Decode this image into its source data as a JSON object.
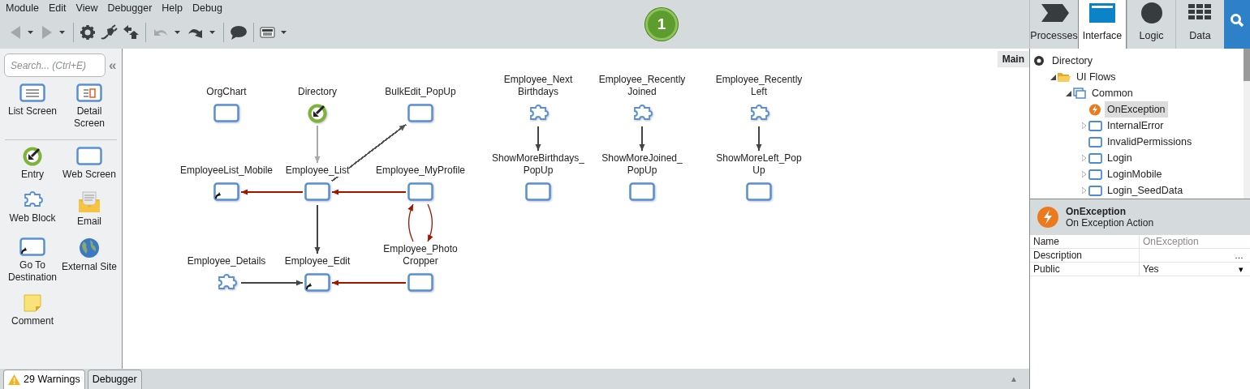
{
  "menu": [
    "Module",
    "Edit",
    "View",
    "Debugger",
    "Help",
    "Debug"
  ],
  "toolbar": [
    {
      "kind": "back",
      "disabled": true,
      "dropdown": true
    },
    {
      "kind": "forward",
      "disabled": true,
      "dropdown": true
    },
    {
      "kind": "separator"
    },
    {
      "kind": "settings",
      "disabled": false,
      "dropdown": false
    },
    {
      "kind": "plug",
      "disabled": false,
      "dropdown": false
    },
    {
      "kind": "publish",
      "disabled": false,
      "dropdown": false
    },
    {
      "kind": "separator"
    },
    {
      "kind": "undo",
      "disabled": true,
      "dropdown": true
    },
    {
      "kind": "redo",
      "disabled": false,
      "dropdown": true
    },
    {
      "kind": "separator"
    },
    {
      "kind": "comment",
      "disabled": false,
      "dropdown": false
    },
    {
      "kind": "separator"
    },
    {
      "kind": "screen",
      "disabled": false,
      "dropdown": true
    }
  ],
  "step_badge": "1",
  "tabs": [
    {
      "label": "Processes",
      "kind": "processes",
      "selected": false
    },
    {
      "label": "Interface",
      "kind": "interface",
      "selected": true
    },
    {
      "label": "Logic",
      "kind": "logic",
      "selected": false
    },
    {
      "label": "Data",
      "kind": "data",
      "selected": false
    }
  ],
  "palette": {
    "search": {
      "placeholder": "Search... (Ctrl+E)"
    },
    "collapse": "«",
    "groups": [
      {
        "items": [
          {
            "label": "List Screen",
            "kind": "list"
          },
          {
            "label": "Detail\nScreen",
            "kind": "detail"
          }
        ]
      },
      {
        "items": [
          {
            "label": "Entry",
            "kind": "entry"
          },
          {
            "label": "Web Screen",
            "kind": "screen"
          },
          {
            "label": "Web Block",
            "kind": "block"
          },
          {
            "label": "Email",
            "kind": "email"
          },
          {
            "label": "Go To\nDestination",
            "kind": "destination"
          },
          {
            "label": "External Site",
            "kind": "external"
          },
          {
            "label": "Comment",
            "kind": "comment"
          }
        ]
      }
    ]
  },
  "canvas": {
    "tag": "Main",
    "nodes": [
      {
        "label": "OrgChart",
        "kind": "screen"
      },
      {
        "label": "Directory",
        "kind": "entry"
      },
      {
        "label": "BulkEdit_PopUp",
        "kind": "screen"
      },
      {
        "label": "Employee_Next\nBirthdays",
        "kind": "block"
      },
      {
        "label": "Employee_Recently\nJoined",
        "kind": "block"
      },
      {
        "label": "Employee_Recently\nLeft",
        "kind": "block"
      },
      {
        "label": "EmployeeList_Mobile",
        "kind": "destination"
      },
      {
        "label": "Employee_List",
        "kind": "screen"
      },
      {
        "label": "Employee_MyProfile",
        "kind": "screen"
      },
      {
        "label": "ShowMoreBirthdays_\nPopUp",
        "kind": "screen"
      },
      {
        "label": "ShowMoreJoined_\nPopUp",
        "kind": "screen"
      },
      {
        "label": "ShowMoreLeft_Pop\nUp",
        "kind": "screen"
      },
      {
        "label": "Employee_Details",
        "kind": "block"
      },
      {
        "label": "Employee_Edit",
        "kind": "destination"
      },
      {
        "label": "Employee_Photo\nCropper",
        "kind": "screen"
      }
    ],
    "edges": [
      {
        "color": "#aaaaaa",
        "curved": false
      },
      {
        "color": "#555555",
        "curved": false
      },
      {
        "color": "#a01400",
        "curved": false
      },
      {
        "color": "#a01400",
        "curved": false
      },
      {
        "color": "#444444",
        "curved": false
      },
      {
        "color": "#444444",
        "curved": false
      },
      {
        "color": "#a01400",
        "curved": false
      },
      {
        "color": "#a01400",
        "curved": true
      },
      {
        "color": "#a01400",
        "curved": true
      },
      {
        "color": "#444444",
        "curved": false
      },
      {
        "color": "#444444",
        "curved": false
      },
      {
        "color": "#444444",
        "curved": false
      }
    ]
  },
  "tree": [
    {
      "label": "Directory",
      "kind": "module",
      "selected": false,
      "children": [
        {
          "label": "UI Flows",
          "kind": "folder",
          "expanded": true,
          "selected": false,
          "children": [
            {
              "label": "Common",
              "kind": "flow",
              "expanded": true,
              "selected": false,
              "children": [
                {
                  "label": "OnException",
                  "kind": "action",
                  "selected": true
                },
                {
                  "label": "InternalError",
                  "kind": "screen",
                  "expanded": false,
                  "selected": false
                },
                {
                  "label": "InvalidPermissions",
                  "kind": "screen",
                  "selected": false
                },
                {
                  "label": "Login",
                  "kind": "screen",
                  "expanded": false,
                  "selected": false
                },
                {
                  "label": "LoginMobile",
                  "kind": "screen",
                  "expanded": false,
                  "selected": false
                },
                {
                  "label": "Login_SeedData",
                  "kind": "screen",
                  "expanded": false,
                  "selected": false
                }
              ]
            }
          ]
        }
      ]
    }
  ],
  "properties": {
    "title": "OnException",
    "subtitle": "On Exception Action",
    "rows": [
      {
        "name": "Name",
        "value": "OnException",
        "readonly": true
      },
      {
        "name": "Description",
        "control": "…"
      },
      {
        "name": "Public",
        "value": "Yes",
        "control": "▾"
      }
    ]
  },
  "bottom_tabs": [
    {
      "label": "29 Warnings",
      "kind": "warnings",
      "selected": true
    },
    {
      "label": "Debugger",
      "kind": "plain",
      "selected": false
    }
  ],
  "panel_toggle": "▲"
}
